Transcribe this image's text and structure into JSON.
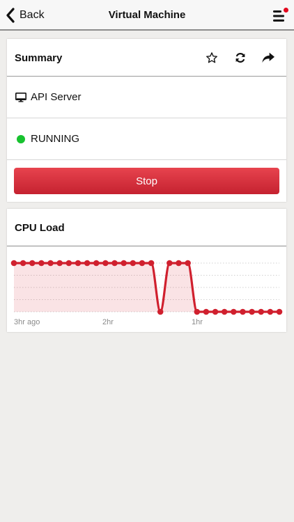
{
  "navbar": {
    "back_label": "Back",
    "title": "Virtual Machine",
    "menu_has_notification": true
  },
  "summary": {
    "title": "Summary",
    "actions": [
      "star-icon",
      "refresh-icon",
      "share-icon"
    ],
    "server_icon": "monitor-icon",
    "server_name": "API Server",
    "status_text": "RUNNING",
    "status_color": "#17c22f",
    "stop_label": "Stop"
  },
  "cpu": {
    "title": "CPU Load"
  },
  "colors": {
    "accent_red": "#d0202e",
    "running_green": "#17c22f",
    "notification_red": "#e3081e"
  },
  "chart_data": {
    "type": "line",
    "title": "CPU Load",
    "x_tick_labels": [
      "3hr ago",
      "2hr",
      "1hr"
    ],
    "y_range": [
      0,
      1
    ],
    "grid": true,
    "series": [
      {
        "color": "#d0202e",
        "values": [
          1,
          1,
          1,
          1,
          1,
          1,
          1,
          1,
          1,
          1,
          1,
          1,
          1,
          1,
          1,
          1,
          0,
          1,
          1,
          1,
          0,
          0,
          0,
          0,
          0,
          0,
          0,
          0,
          0,
          0
        ]
      }
    ]
  }
}
